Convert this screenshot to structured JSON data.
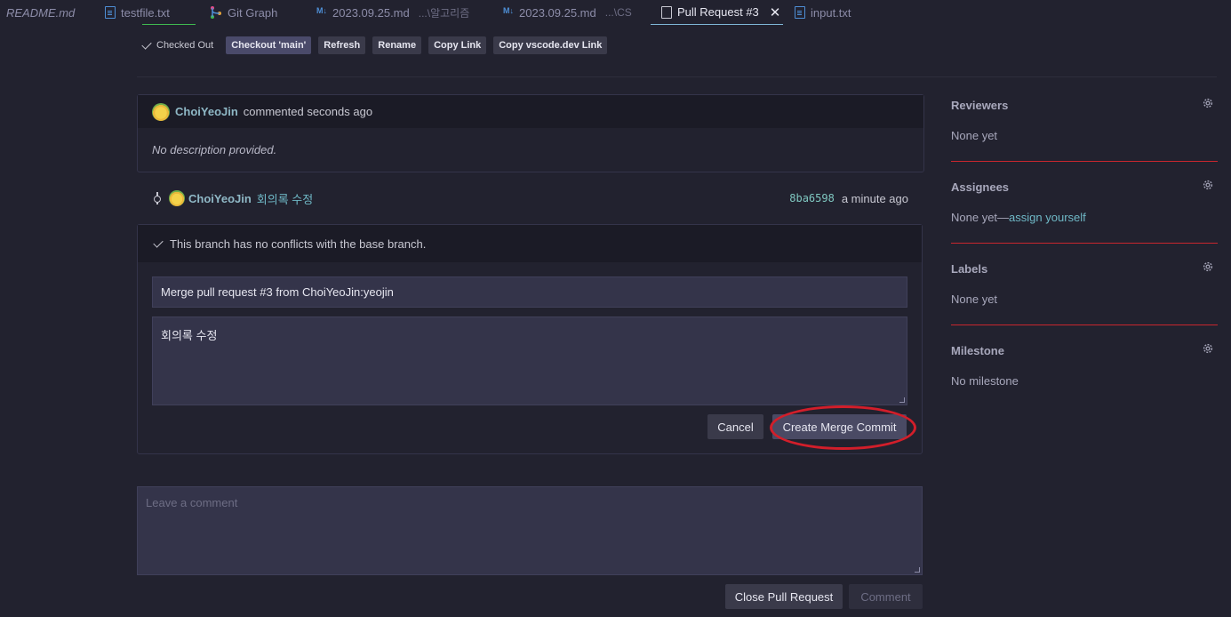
{
  "tabs": [
    {
      "label": "README.md",
      "sub": "",
      "icon": "none"
    },
    {
      "label": "testfile.txt",
      "sub": "",
      "icon": "file-icon"
    },
    {
      "label": "Git Graph",
      "sub": "",
      "icon": "git-graph-icon"
    },
    {
      "label": "2023.09.25.md",
      "sub": "...\\알고리즘",
      "icon": "markdown-icon"
    },
    {
      "label": "2023.09.25.md",
      "sub": "...\\CS",
      "icon": "markdown-icon"
    },
    {
      "label": "Pull Request #3",
      "sub": "",
      "icon": "page-icon"
    },
    {
      "label": "input.txt",
      "sub": "",
      "icon": "file-icon"
    }
  ],
  "toolbar": {
    "checked_out": "Checked Out",
    "checkout_main": "Checkout 'main'",
    "refresh": "Refresh",
    "rename": "Rename",
    "copy_link": "Copy Link",
    "copy_vscode_link": "Copy vscode.dev Link"
  },
  "comment": {
    "author": "ChoiYeoJin",
    "action": "commented seconds ago",
    "body": "No description provided."
  },
  "commit": {
    "author": "ChoiYeoJin",
    "message": "회의록 수정",
    "sha": "8ba6598",
    "time": "a minute ago"
  },
  "merge": {
    "status": "This branch has no conflicts with the base branch.",
    "title": "Merge pull request #3 from ChoiYeoJin:yeojin",
    "message": "회의록 수정",
    "cancel": "Cancel",
    "create": "Create Merge Commit"
  },
  "new_comment": {
    "placeholder": "Leave a comment",
    "close_pr": "Close Pull Request",
    "comment": "Comment"
  },
  "sidebar": {
    "reviewers": {
      "title": "Reviewers",
      "value": "None yet"
    },
    "assignees": {
      "title": "Assignees",
      "value": "None yet—",
      "link": "assign yourself"
    },
    "labels": {
      "title": "Labels",
      "value": "None yet"
    },
    "milestone": {
      "title": "Milestone",
      "value": "No milestone"
    }
  },
  "colors": {
    "accent": "#6fb8c6",
    "annotation_ring": "#d21e2a",
    "background": "#22222f"
  }
}
